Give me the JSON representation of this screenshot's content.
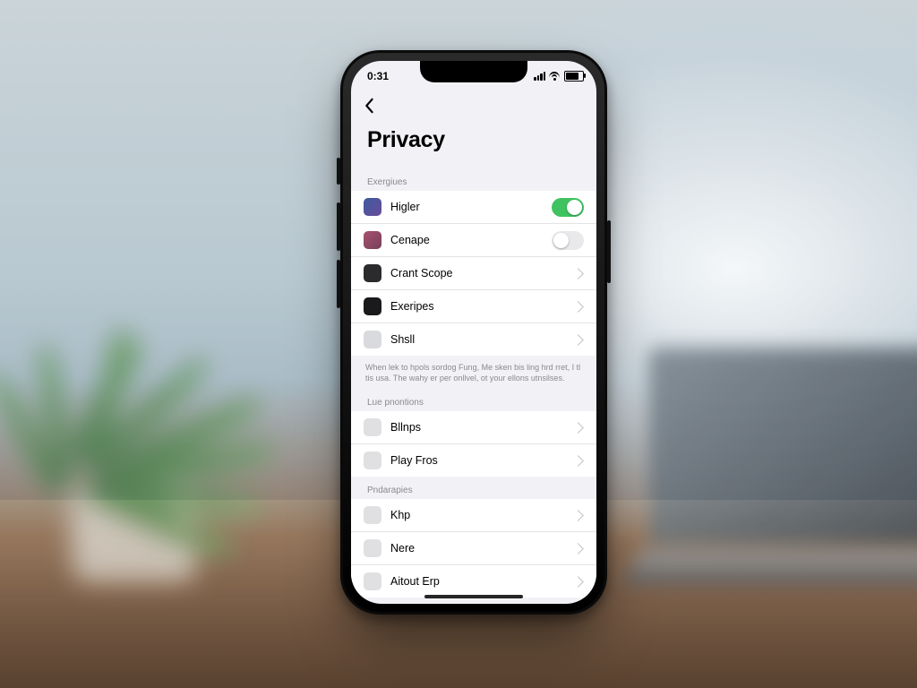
{
  "status": {
    "time": "0:31"
  },
  "page": {
    "title": "Privacy"
  },
  "sections": [
    {
      "header": "Exergiues",
      "rows": [
        {
          "label": "Higler",
          "control": "toggle-on",
          "icon": "ic-a"
        },
        {
          "label": "Cenape",
          "control": "toggle-off",
          "icon": "ic-b"
        },
        {
          "label": "Crant Scope",
          "control": "chevron",
          "icon": "ic-c"
        },
        {
          "label": "Exeripes",
          "control": "chevron",
          "icon": "ic-d"
        },
        {
          "label": "Shsll",
          "control": "chevron",
          "icon": "ic-e"
        }
      ],
      "footer": "When lek to hpols sordog Fung, Me sken bis ling hrd rret, I tl tis usa. The wahy er per onllvel, ot your ellons utnsilses."
    },
    {
      "header": "Lue pnontions",
      "rows": [
        {
          "label": "Bllnps",
          "control": "chevron",
          "icon": "ic-f"
        },
        {
          "label": "Play Fros",
          "control": "chevron",
          "icon": "ic-g"
        }
      ]
    },
    {
      "header": "Pndarapies",
      "rows": [
        {
          "label": "Khp",
          "control": "chevron",
          "icon": "ic-f"
        },
        {
          "label": "Nere",
          "control": "chevron",
          "icon": "ic-f"
        },
        {
          "label": "Aitout Erp",
          "control": "chevron",
          "icon": "ic-f"
        }
      ]
    }
  ]
}
